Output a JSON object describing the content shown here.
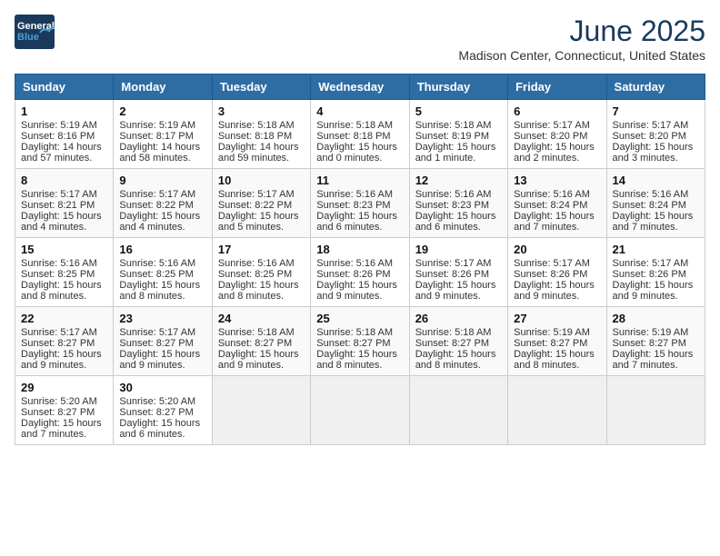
{
  "header": {
    "logo_line1": "General",
    "logo_line2": "Blue",
    "month": "June 2025",
    "location": "Madison Center, Connecticut, United States"
  },
  "days_of_week": [
    "Sunday",
    "Monday",
    "Tuesday",
    "Wednesday",
    "Thursday",
    "Friday",
    "Saturday"
  ],
  "weeks": [
    [
      {
        "day": "1",
        "sunrise": "5:19 AM",
        "sunset": "8:16 PM",
        "daylight": "14 hours and 57 minutes."
      },
      {
        "day": "2",
        "sunrise": "5:19 AM",
        "sunset": "8:17 PM",
        "daylight": "14 hours and 58 minutes."
      },
      {
        "day": "3",
        "sunrise": "5:18 AM",
        "sunset": "8:18 PM",
        "daylight": "14 hours and 59 minutes."
      },
      {
        "day": "4",
        "sunrise": "5:18 AM",
        "sunset": "8:18 PM",
        "daylight": "15 hours and 0 minutes."
      },
      {
        "day": "5",
        "sunrise": "5:18 AM",
        "sunset": "8:19 PM",
        "daylight": "15 hours and 1 minute."
      },
      {
        "day": "6",
        "sunrise": "5:17 AM",
        "sunset": "8:20 PM",
        "daylight": "15 hours and 2 minutes."
      },
      {
        "day": "7",
        "sunrise": "5:17 AM",
        "sunset": "8:20 PM",
        "daylight": "15 hours and 3 minutes."
      }
    ],
    [
      {
        "day": "8",
        "sunrise": "5:17 AM",
        "sunset": "8:21 PM",
        "daylight": "15 hours and 4 minutes."
      },
      {
        "day": "9",
        "sunrise": "5:17 AM",
        "sunset": "8:22 PM",
        "daylight": "15 hours and 4 minutes."
      },
      {
        "day": "10",
        "sunrise": "5:17 AM",
        "sunset": "8:22 PM",
        "daylight": "15 hours and 5 minutes."
      },
      {
        "day": "11",
        "sunrise": "5:16 AM",
        "sunset": "8:23 PM",
        "daylight": "15 hours and 6 minutes."
      },
      {
        "day": "12",
        "sunrise": "5:16 AM",
        "sunset": "8:23 PM",
        "daylight": "15 hours and 6 minutes."
      },
      {
        "day": "13",
        "sunrise": "5:16 AM",
        "sunset": "8:24 PM",
        "daylight": "15 hours and 7 minutes."
      },
      {
        "day": "14",
        "sunrise": "5:16 AM",
        "sunset": "8:24 PM",
        "daylight": "15 hours and 7 minutes."
      }
    ],
    [
      {
        "day": "15",
        "sunrise": "5:16 AM",
        "sunset": "8:25 PM",
        "daylight": "15 hours and 8 minutes."
      },
      {
        "day": "16",
        "sunrise": "5:16 AM",
        "sunset": "8:25 PM",
        "daylight": "15 hours and 8 minutes."
      },
      {
        "day": "17",
        "sunrise": "5:16 AM",
        "sunset": "8:25 PM",
        "daylight": "15 hours and 8 minutes."
      },
      {
        "day": "18",
        "sunrise": "5:16 AM",
        "sunset": "8:26 PM",
        "daylight": "15 hours and 9 minutes."
      },
      {
        "day": "19",
        "sunrise": "5:17 AM",
        "sunset": "8:26 PM",
        "daylight": "15 hours and 9 minutes."
      },
      {
        "day": "20",
        "sunrise": "5:17 AM",
        "sunset": "8:26 PM",
        "daylight": "15 hours and 9 minutes."
      },
      {
        "day": "21",
        "sunrise": "5:17 AM",
        "sunset": "8:26 PM",
        "daylight": "15 hours and 9 minutes."
      }
    ],
    [
      {
        "day": "22",
        "sunrise": "5:17 AM",
        "sunset": "8:27 PM",
        "daylight": "15 hours and 9 minutes."
      },
      {
        "day": "23",
        "sunrise": "5:17 AM",
        "sunset": "8:27 PM",
        "daylight": "15 hours and 9 minutes."
      },
      {
        "day": "24",
        "sunrise": "5:18 AM",
        "sunset": "8:27 PM",
        "daylight": "15 hours and 9 minutes."
      },
      {
        "day": "25",
        "sunrise": "5:18 AM",
        "sunset": "8:27 PM",
        "daylight": "15 hours and 8 minutes."
      },
      {
        "day": "26",
        "sunrise": "5:18 AM",
        "sunset": "8:27 PM",
        "daylight": "15 hours and 8 minutes."
      },
      {
        "day": "27",
        "sunrise": "5:19 AM",
        "sunset": "8:27 PM",
        "daylight": "15 hours and 8 minutes."
      },
      {
        "day": "28",
        "sunrise": "5:19 AM",
        "sunset": "8:27 PM",
        "daylight": "15 hours and 7 minutes."
      }
    ],
    [
      {
        "day": "29",
        "sunrise": "5:20 AM",
        "sunset": "8:27 PM",
        "daylight": "15 hours and 7 minutes."
      },
      {
        "day": "30",
        "sunrise": "5:20 AM",
        "sunset": "8:27 PM",
        "daylight": "15 hours and 6 minutes."
      },
      null,
      null,
      null,
      null,
      null
    ]
  ]
}
